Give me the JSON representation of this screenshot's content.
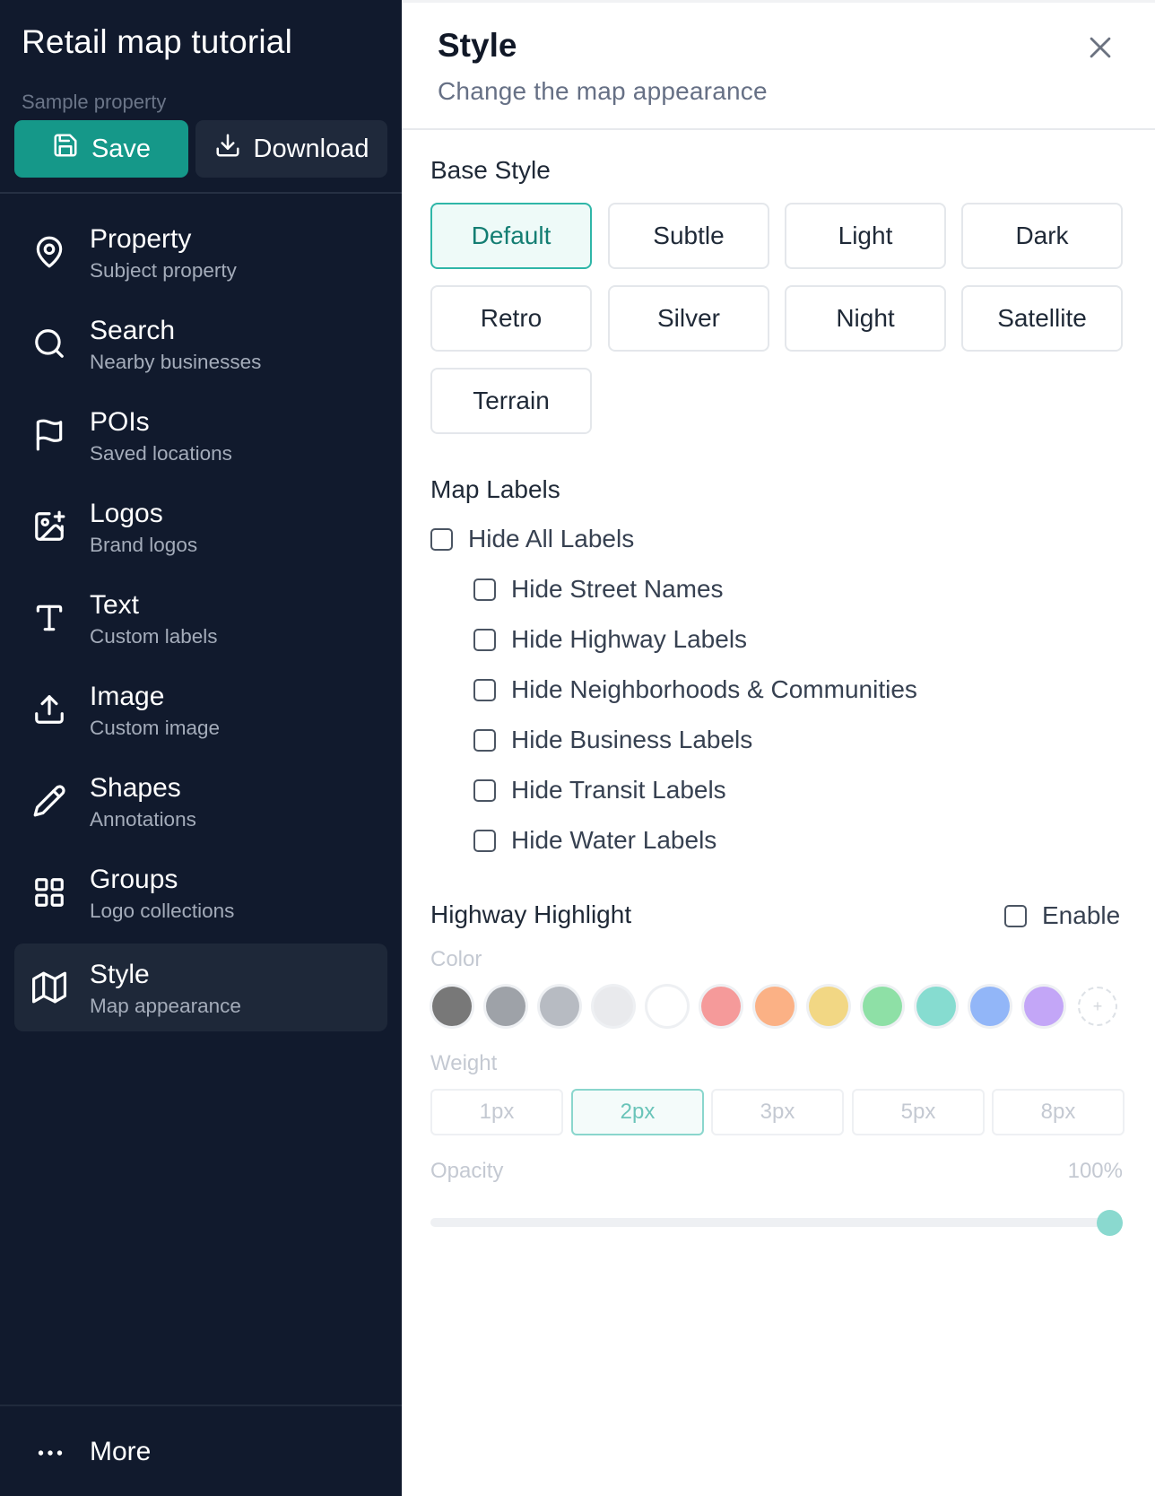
{
  "sidebar": {
    "app_title": "Retail map tutorial",
    "subtitle": "Sample property",
    "save_label": "Save",
    "download_label": "Download",
    "items": [
      {
        "label": "Property",
        "desc": "Subject property",
        "icon": "map-pin-icon"
      },
      {
        "label": "Search",
        "desc": "Nearby businesses",
        "icon": "search-icon"
      },
      {
        "label": "POIs",
        "desc": "Saved locations",
        "icon": "flag-icon"
      },
      {
        "label": "Logos",
        "desc": "Brand logos",
        "icon": "image-plus-icon"
      },
      {
        "label": "Text",
        "desc": "Custom labels",
        "icon": "type-icon"
      },
      {
        "label": "Image",
        "desc": "Custom image",
        "icon": "upload-icon"
      },
      {
        "label": "Shapes",
        "desc": "Annotations",
        "icon": "pencil-icon"
      },
      {
        "label": "Groups",
        "desc": "Logo collections",
        "icon": "grid-icon"
      },
      {
        "label": "Style",
        "desc": "Map appearance",
        "icon": "map-icon",
        "active": true
      }
    ],
    "more_label": "More"
  },
  "panel": {
    "title": "Style",
    "subtitle": "Change the map appearance",
    "base_style": {
      "title": "Base Style",
      "options": [
        "Default",
        "Subtle",
        "Light",
        "Dark",
        "Retro",
        "Silver",
        "Night",
        "Satellite",
        "Terrain"
      ],
      "selected": "Default"
    },
    "map_labels": {
      "title": "Map Labels",
      "hide_all": "Hide All Labels",
      "options": [
        "Hide Street Names",
        "Hide Highway Labels",
        "Hide Neighborhoods & Communities",
        "Hide Business Labels",
        "Hide Transit Labels",
        "Hide Water Labels"
      ]
    },
    "highway": {
      "title": "Highway Highlight",
      "enable_label": "Enable",
      "color_label": "Color",
      "colors": [
        "#787878",
        "#9ea2a8",
        "#b7bbc2",
        "#e9eaed",
        "#ffffff",
        "#f59a9a",
        "#fbb185",
        "#f2d784",
        "#8ee0a6",
        "#86dcd0",
        "#92b6f8",
        "#c3a6f7"
      ],
      "add_color_icon": "plus-icon",
      "weight_label": "Weight",
      "weights": [
        "1px",
        "2px",
        "3px",
        "5px",
        "8px"
      ],
      "selected_weight": "2px",
      "opacity_label": "Opacity",
      "opacity_value": "100%",
      "opacity_fraction": 1.0
    }
  }
}
